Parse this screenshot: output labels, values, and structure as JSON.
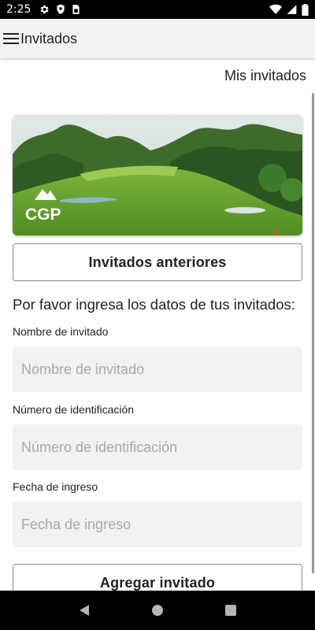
{
  "status_bar": {
    "time": "2:25",
    "left_icons": [
      "gear-icon",
      "shield-icon",
      "sim-card-icon"
    ],
    "right_icons": [
      "wifi-icon",
      "signal-icon",
      "battery-icon"
    ]
  },
  "app_bar": {
    "title": "Invitados",
    "menu_icon": "hamburger-menu-icon"
  },
  "main": {
    "my_guests_link": "Mis invitados",
    "hero_image_logo": "CGP",
    "previous_guests_button": "Invitados anteriores",
    "instructions": "Por favor ingresa los datos de tus invitados:",
    "fields": [
      {
        "label": "Nombre de invitado",
        "placeholder": "Nombre de invitado",
        "value": ""
      },
      {
        "label": "Número de identificación",
        "placeholder": "Número de identificación",
        "value": ""
      },
      {
        "label": "Fecha de ingreso",
        "placeholder": "Fecha de ingreso",
        "value": ""
      }
    ],
    "add_guest_button": "Agregar invitado"
  },
  "nav_bar": {
    "buttons": [
      "back-icon",
      "home-icon",
      "recents-icon"
    ]
  }
}
